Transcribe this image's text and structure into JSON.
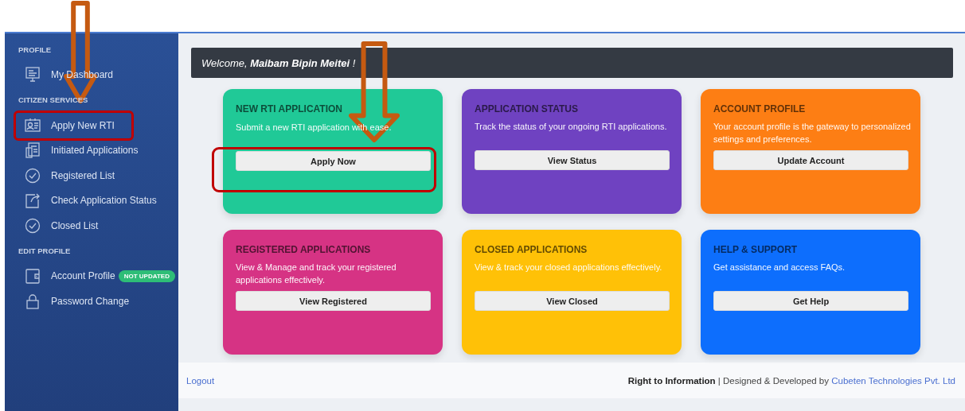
{
  "sidebar": {
    "sections": [
      {
        "heading": "PROFILE",
        "items": [
          {
            "label": "My Dashboard",
            "annotated": false
          }
        ]
      },
      {
        "heading": "CITIZEN SERVICES",
        "items": [
          {
            "label": "Apply New RTI",
            "annotated": true
          },
          {
            "label": "Initiated Applications",
            "annotated": false
          },
          {
            "label": "Registered List",
            "annotated": false
          },
          {
            "label": "Check Application Status",
            "annotated": false
          },
          {
            "label": "Closed List",
            "annotated": false
          }
        ]
      },
      {
        "heading": "EDIT PROFILE",
        "items": [
          {
            "label": "Account Profile",
            "badge": "NOT UPDATED",
            "annotated": false
          },
          {
            "label": "Password Change",
            "annotated": false
          }
        ]
      }
    ]
  },
  "welcome": "Welcome, **Maibam Bipin Meitei** !",
  "cards": [
    {
      "title": "NEW RTI APPLICATION",
      "description": "Submit a new RTI application with ease.",
      "button": "Apply Now",
      "color": "#20c997",
      "annotated": true
    },
    {
      "title": "APPLICATION STATUS",
      "description": "Track the status of your ongoing RTI applications.",
      "button": "View Status",
      "color": "#6f42c1",
      "annotated": false
    },
    {
      "title": "ACCOUNT PROFILE",
      "description": "Your account profile is the gateway to personalized settings and preferences.",
      "button": "Update Account",
      "color": "#fd7e14",
      "annotated": false
    },
    {
      "title": "REGISTERED APPLICATIONS",
      "description": "View & Manage and track your registered applications effectively.",
      "button": "View Registered",
      "color": "#d63384",
      "annotated": false
    },
    {
      "title": "CLOSED APPLICATIONS",
      "description": "View & track your closed applications effectively.",
      "button": "View Closed",
      "color": "#ffc107",
      "annotated": false
    },
    {
      "title": "HELP & SUPPORT",
      "description": "Get assistance and access FAQs.",
      "button": "Get Help",
      "color": "#0d6efd",
      "annotated": false
    }
  ],
  "footer": {
    "logout": "Logout",
    "credit": "**Right to Information** | Designed & Developed by",
    "credit_link": "Cubeten Technologies Pvt. Ltd"
  }
}
